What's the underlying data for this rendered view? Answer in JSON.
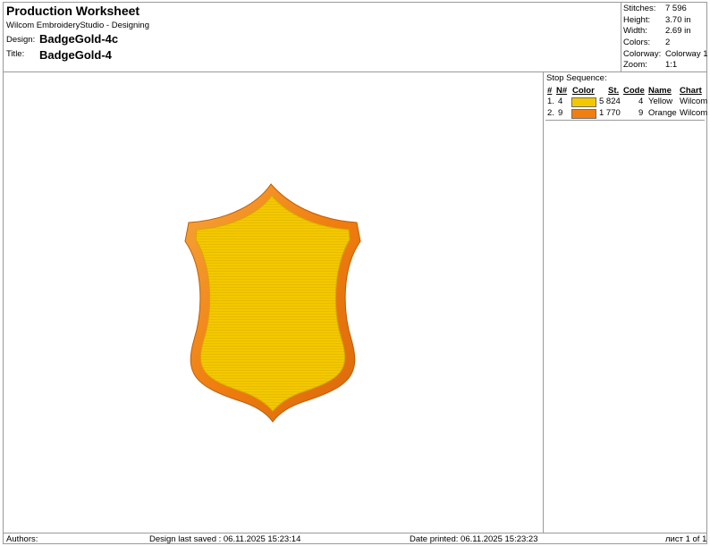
{
  "header": {
    "title": "Production Worksheet",
    "subtitle": "Wilcom EmbroideryStudio - Designing",
    "design_label": "Design:",
    "design_value": "BadgeGold-4c",
    "title_label": "Title:",
    "title_value": "BadgeGold-4"
  },
  "stats": [
    {
      "label": "Stitches:",
      "value": "7 596"
    },
    {
      "label": "Height:",
      "value": "3.70 in"
    },
    {
      "label": "Width:",
      "value": "2.69 in"
    },
    {
      "label": "Colors:",
      "value": "2"
    },
    {
      "label": "Colorway:",
      "value": "Colorway 1"
    },
    {
      "label": "Zoom:",
      "value": "1:1"
    }
  ],
  "stop_sequence": {
    "title": "Stop Sequence:",
    "headers": {
      "num": "#",
      "n": "N#",
      "color": "Color",
      "st": "St.",
      "code": "Code",
      "name": "Name",
      "chart": "Chart"
    },
    "rows": [
      {
        "num": "1.",
        "n": "4",
        "swatch": "#f3c800",
        "st": "5 824",
        "code": "4",
        "name": "Yellow",
        "chart": "Wilcom"
      },
      {
        "num": "2.",
        "n": "9",
        "swatch": "#f07e10",
        "st": "1 770",
        "code": "9",
        "name": "Orange",
        "chart": "Wilcom"
      }
    ]
  },
  "design_colors": {
    "fill": "#f3c800",
    "border": "#f07e10"
  },
  "footer": {
    "authors": "Authors:",
    "saved": "Design last saved : 06.11.2025 15:23:14",
    "printed": "Date printed: 06.11.2025 15:23:23",
    "page": "лист 1 of 1"
  }
}
